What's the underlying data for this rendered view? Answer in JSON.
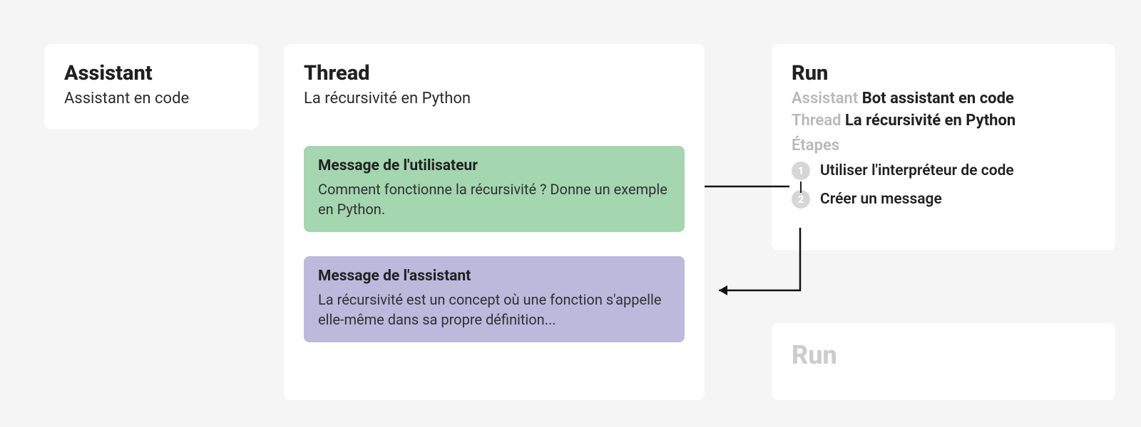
{
  "assistant": {
    "title": "Assistant",
    "subtitle": "Assistant en code"
  },
  "thread": {
    "title": "Thread",
    "subtitle": "La récursivité en Python",
    "userMessage": {
      "title": "Message de l'utilisateur",
      "body": "Comment fonctionne la récursivité ? Donne un exemple en Python."
    },
    "assistantMessage": {
      "title": "Message de l'assistant",
      "body": "La récursivité est un concept où une fonction s'appelle elle-même dans sa propre définition..."
    }
  },
  "run": {
    "title": "Run",
    "assistantLabel": "Assistant",
    "assistantValue": "Bot assistant en code",
    "threadLabel": "Thread",
    "threadValue": "La récursivité en Python",
    "stepsLabel": "Étapes",
    "steps": [
      {
        "num": "1",
        "text": "Utiliser l'interpréteur de code"
      },
      {
        "num": "2",
        "text": "Créer un message"
      }
    ]
  },
  "run2": {
    "title": "Run"
  }
}
